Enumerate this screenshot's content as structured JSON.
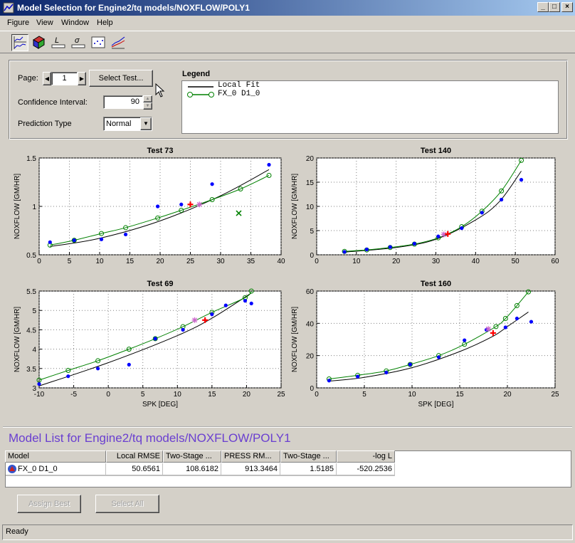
{
  "window": {
    "title": "Model Selection for Engine2/tq models/NOXFLOW/POLY1",
    "minimize": "_",
    "maximize": "□",
    "close": "×"
  },
  "menu": [
    "Figure",
    "View",
    "Window",
    "Help"
  ],
  "toolbar": {
    "icons": [
      "response-plot-icon",
      "surface-3d-icon",
      "likelihood-icon",
      "rmse-icon",
      "residuals-icon",
      "cross-section-icon"
    ]
  },
  "controls": {
    "page_label": "Page:",
    "page_value": "1",
    "select_test_label": "Select Test...",
    "confidence_label": "Confidence Interval:",
    "confidence_value": "90",
    "prediction_label": "Prediction Type",
    "prediction_value": "Normal"
  },
  "legend": {
    "title": "Legend",
    "items": [
      {
        "label": "Local Fit",
        "color": "#000000",
        "marker": "line"
      },
      {
        "label": "FX_0 D1_0",
        "color": "#008000",
        "marker": "circle"
      }
    ]
  },
  "colors": {
    "data_points": "#0000ff",
    "local_fit": "#000000",
    "global_fit": "#008000",
    "highlight": "#ff0000",
    "star": "#cc66cc"
  },
  "chart_data": [
    {
      "type": "scatter",
      "title": "Test 73",
      "ylabel": "NOXFLOW [GM/HR]",
      "xlabel": "",
      "xlim": [
        0,
        40
      ],
      "ylim": [
        0.5,
        1.5
      ],
      "xticks": [
        0,
        5,
        10,
        15,
        20,
        25,
        30,
        35,
        40
      ],
      "yticks": [
        0.5,
        1,
        1.5
      ],
      "ytick_labels": [
        "0.5",
        "1",
        "1.5"
      ],
      "grid": true,
      "points": [
        [
          1.8,
          0.63
        ],
        [
          5.8,
          0.65
        ],
        [
          10.3,
          0.66
        ],
        [
          14.3,
          0.71
        ],
        [
          19.6,
          1.0
        ],
        [
          23.5,
          1.02
        ],
        [
          28.6,
          1.23
        ],
        [
          38.0,
          1.43
        ]
      ],
      "local_fit": [
        [
          1.8,
          0.585
        ],
        [
          10,
          0.67
        ],
        [
          20,
          0.85
        ],
        [
          30,
          1.11
        ],
        [
          38,
          1.38
        ]
      ],
      "global_fit": [
        [
          1.8,
          0.6
        ],
        [
          5.8,
          0.65
        ],
        [
          10.3,
          0.72
        ],
        [
          14.3,
          0.78
        ],
        [
          19.6,
          0.88
        ],
        [
          23.5,
          0.96
        ],
        [
          28.6,
          1.07
        ],
        [
          33.3,
          1.18
        ],
        [
          38.0,
          1.32
        ]
      ],
      "highlight": [
        [
          25.0,
          1.02
        ]
      ],
      "star": [
        [
          26.5,
          1.02
        ]
      ],
      "excluded": [
        [
          33.0,
          0.93
        ]
      ]
    },
    {
      "type": "scatter",
      "title": "Test 140",
      "ylabel": "NOXFLOW [GM/HR]",
      "xlabel": "",
      "xlim": [
        0,
        60
      ],
      "ylim": [
        0,
        20
      ],
      "xticks": [
        0,
        10,
        20,
        30,
        40,
        50,
        60
      ],
      "yticks": [
        0,
        5,
        10,
        15,
        20
      ],
      "ytick_labels": [
        "0",
        "5",
        "10",
        "15",
        "20"
      ],
      "grid": true,
      "points": [
        [
          7,
          0.6
        ],
        [
          12.6,
          1.1
        ],
        [
          18.5,
          1.6
        ],
        [
          24.6,
          2.3
        ],
        [
          30.6,
          3.8
        ],
        [
          36.5,
          5.5
        ],
        [
          41.6,
          8.7
        ],
        [
          46.5,
          11.4
        ],
        [
          51.5,
          15.5
        ]
      ],
      "local_fit": [
        [
          7,
          0.55
        ],
        [
          20,
          1.5
        ],
        [
          30,
          3.2
        ],
        [
          40,
          7.2
        ],
        [
          46,
          11.0
        ],
        [
          51.5,
          17.3
        ]
      ],
      "global_fit": [
        [
          7,
          0.7
        ],
        [
          12.6,
          1.0
        ],
        [
          18.5,
          1.5
        ],
        [
          24.6,
          2.2
        ],
        [
          30.6,
          3.5
        ],
        [
          36.5,
          5.8
        ],
        [
          41.6,
          9.0
        ],
        [
          46.5,
          13.2
        ],
        [
          51.5,
          19.5
        ]
      ],
      "highlight": [
        [
          33.0,
          4.3
        ]
      ],
      "star": [
        [
          32.0,
          4.2
        ]
      ],
      "excluded": []
    },
    {
      "type": "scatter",
      "title": "Test 69",
      "ylabel": "NOXFLOW [GM/HR]",
      "xlabel": "SPK [DEG]",
      "xlim": [
        -10,
        25
      ],
      "ylim": [
        3,
        5.5
      ],
      "xticks": [
        -10,
        -5,
        0,
        5,
        10,
        15,
        20,
        25
      ],
      "yticks": [
        3,
        3.5,
        4,
        4.5,
        5,
        5.5
      ],
      "ytick_labels": [
        "3",
        "3.5",
        "4",
        "4.5",
        "5",
        "5.5"
      ],
      "grid": true,
      "points": [
        [
          -10,
          3.1
        ],
        [
          -5.8,
          3.3
        ],
        [
          -1.5,
          3.5
        ],
        [
          3.0,
          3.6
        ],
        [
          6.8,
          4.27
        ],
        [
          10.8,
          4.5
        ],
        [
          15.0,
          4.9
        ],
        [
          17.0,
          5.13
        ],
        [
          19.8,
          5.25
        ],
        [
          20.7,
          5.18
        ]
      ],
      "local_fit": [
        [
          -10,
          3.05
        ],
        [
          0,
          3.65
        ],
        [
          10,
          4.35
        ],
        [
          15,
          4.8
        ],
        [
          20.7,
          5.45
        ]
      ],
      "global_fit": [
        [
          -10,
          3.2
        ],
        [
          -5.8,
          3.45
        ],
        [
          -1.5,
          3.7
        ],
        [
          3.0,
          4.0
        ],
        [
          6.8,
          4.27
        ],
        [
          10.8,
          4.58
        ],
        [
          15.0,
          4.95
        ],
        [
          19.8,
          5.33
        ],
        [
          20.7,
          5.5
        ]
      ],
      "highlight": [
        [
          14.0,
          4.75
        ]
      ],
      "star": [
        [
          12.5,
          4.75
        ]
      ],
      "excluded": []
    },
    {
      "type": "scatter",
      "title": "Test 160",
      "ylabel": "NOXFLOW [GM/HR]",
      "xlabel": "SPK [DEG]",
      "xlim": [
        0,
        25
      ],
      "ylim": [
        0,
        60
      ],
      "xticks": [
        0,
        5,
        10,
        15,
        20,
        25
      ],
      "yticks": [
        0,
        20,
        40,
        60
      ],
      "ytick_labels": [
        "0",
        "20",
        "40",
        "60"
      ],
      "grid": true,
      "points": [
        [
          1.3,
          4.5
        ],
        [
          4.3,
          7.0
        ],
        [
          7.3,
          9.5
        ],
        [
          9.8,
          14.5
        ],
        [
          12.8,
          19.0
        ],
        [
          15.5,
          29.5
        ],
        [
          17.8,
          36.0
        ],
        [
          19.8,
          37.5
        ],
        [
          21.0,
          43.0
        ],
        [
          22.5,
          41.0
        ]
      ],
      "local_fit": [
        [
          1.3,
          4.2
        ],
        [
          5,
          6.5
        ],
        [
          10,
          12.5
        ],
        [
          15,
          22.5
        ],
        [
          18.5,
          32.0
        ],
        [
          20,
          38.0
        ],
        [
          22.2,
          47.0
        ]
      ],
      "global_fit": [
        [
          1.3,
          5.5
        ],
        [
          4.3,
          7.8
        ],
        [
          7.3,
          10.5
        ],
        [
          9.8,
          14.5
        ],
        [
          12.8,
          20.0
        ],
        [
          15.5,
          27.0
        ],
        [
          18.8,
          38.0
        ],
        [
          19.8,
          43.0
        ],
        [
          21.0,
          51.0
        ],
        [
          22.2,
          59.5
        ]
      ],
      "highlight": [
        [
          18.5,
          34.0
        ]
      ],
      "star": [
        [
          18.0,
          36.5
        ]
      ],
      "excluded": []
    }
  ],
  "model_list": {
    "title": "Model List for Engine2/tq models/NOXFLOW/POLY1",
    "columns": [
      "Model",
      "Local RMSE",
      "Two-Stage ...",
      "PRESS RM...",
      "Two-Stage ...",
      "-log L"
    ],
    "rows": [
      [
        "FX_0 D1_0",
        "50.6561",
        "108.6182",
        "913.3464",
        "1.5185",
        "-520.2536"
      ]
    ]
  },
  "buttons": {
    "assign_best": "Assign Best",
    "select_all": "Select All"
  },
  "status": "Ready"
}
